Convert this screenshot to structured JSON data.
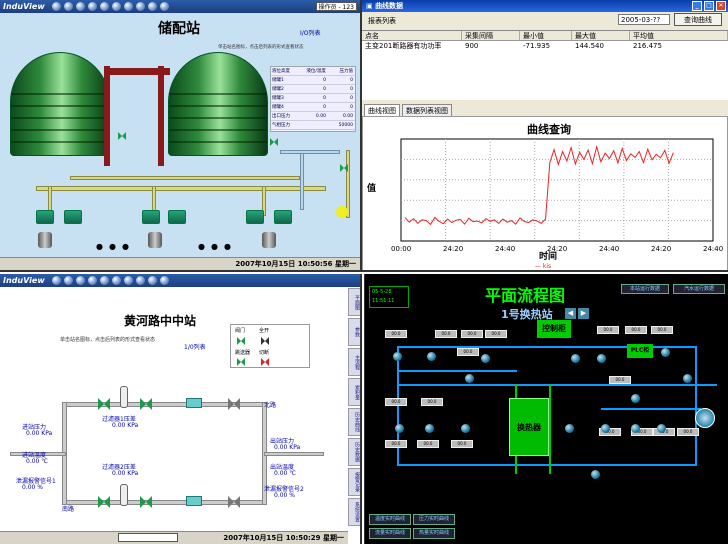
{
  "q1": {
    "logo": "InduView",
    "user": "操作员 - 123",
    "title": "储配站",
    "subtitle": "I/O列表",
    "note": "单击站名图标，点击后列表的形式查看状态",
    "table_rows": [
      [
        "液位高度",
        "液位/温度",
        "压力值"
      ],
      [
        "储罐1",
        "0",
        "0"
      ],
      [
        "储罐2",
        "0",
        "0"
      ],
      [
        "储罐3",
        "0",
        "0"
      ],
      [
        "储罐4",
        "0",
        "0"
      ],
      [
        "出口压力",
        "0.00",
        "0.00"
      ],
      [
        "气相压力",
        "",
        "50000"
      ]
    ],
    "status": "2007年10月15日 10:50:56 星期一"
  },
  "q2": {
    "window_title": "曲线数据",
    "report_label": "报表列表",
    "date": "2005-03-??",
    "query_button": "查询曲线",
    "columns": [
      "点名",
      "采集间隔",
      "最小值",
      "最大值",
      "平均值"
    ],
    "row": [
      "主变201断路器有功功率",
      "900",
      "-71.935",
      "144.540",
      "216.475"
    ],
    "tabs": [
      "曲线视图",
      "数据列表视图"
    ],
    "chart_title": "曲线查询",
    "ylabel": "值",
    "xlabel": "时间",
    "legend": "— kis",
    "chart_data": {
      "type": "line",
      "title": "曲线查询",
      "xlabel": "时间",
      "ylabel": "值",
      "x_ticks": [
        "00:00",
        "24:20",
        "24:40",
        "24:20",
        "24:40",
        "24:20",
        "24:40"
      ],
      "ylim": [
        -100,
        160
      ],
      "series": [
        {
          "name": "kis",
          "color": "#ee2222",
          "values": [
            -40,
            -52,
            -43,
            -55,
            -46,
            -48,
            -58,
            -40,
            -50,
            -56,
            -44,
            -53,
            -47,
            -45,
            -57,
            -42,
            -51,
            -49,
            -54,
            -43,
            -50,
            -46,
            -55,
            -44,
            -52,
            -48,
            -57,
            -41,
            -50,
            -53,
            -46,
            -49,
            -55,
            -44,
            100,
            133,
            95,
            128,
            104,
            138,
            96,
            126,
            108,
            132,
            97,
            140,
            102,
            124,
            110,
            130,
            99,
            136,
            105,
            122,
            113,
            128,
            100,
            134,
            107,
            121,
            112,
            131,
            98,
            125
          ]
        }
      ]
    }
  },
  "q3": {
    "logo": "InduView",
    "title": "黄河路中中站",
    "subtitle": "1/0列表",
    "note": "单击站名图标，点击后列表的形式查看状态",
    "legend": [
      "阀门",
      "全开",
      "跳送器",
      "切断"
    ],
    "labels": {
      "pressure_in": "进站压力",
      "pressure_in_val": "0.00 KPa",
      "temp_in": "进站温度",
      "temp_in_val": "0.00 ℃",
      "leak1": "泄漏报警信号1",
      "leak1_val": "0.00 %",
      "filter1": "过滤器1压差",
      "filter1_val": "0.00 KPa",
      "filter2": "过滤器2压差",
      "filter2_val": "0.00 KPa",
      "pressure_out": "出站压力",
      "pressure_out_val": "0.00 KPa",
      "temp_out": "出站温度",
      "temp_out_val": "0.00 ℃",
      "leak2": "泄漏报警信号2",
      "leak2_val": "0.00 %",
      "north": "北路",
      "south": "南路"
    },
    "status": "2007年10月15日 10:50:29 星期一",
    "sidebar": [
      "平面图",
      "参数",
      "主流程",
      "累积量",
      "历史曲线",
      "历史数据",
      "报警记录",
      "系统设置"
    ]
  },
  "q4": {
    "title": "平面流程图",
    "subtitle": "1号换热站",
    "date": "05-5-28",
    "time": "11:51:11",
    "nav": [
      "本站运行数据",
      "汽水运行数据"
    ],
    "control_cabinet": "控制柜",
    "plc": "PLC柜",
    "exchanger": "换热器",
    "bottom": [
      "温度实时曲线",
      "压力实时曲线",
      "流量实时曲线",
      "热量实时曲线"
    ]
  }
}
